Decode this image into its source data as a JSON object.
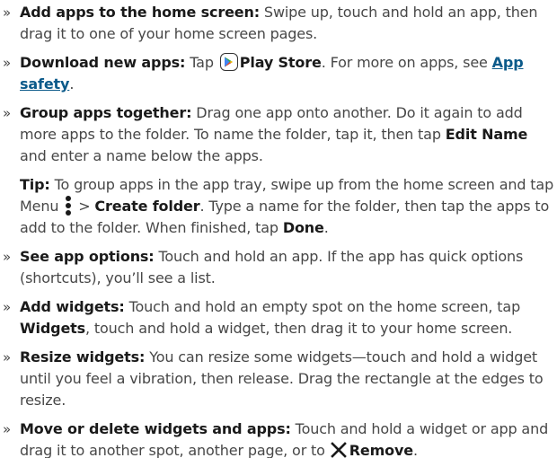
{
  "bullet_glyph": "»",
  "items": [
    {
      "title": "Add apps to the home screen:",
      "text": " Swipe up, touch and hold an app, then drag it to one of your home screen pages."
    },
    {
      "title": "Download new apps:",
      "text_before": " Tap ",
      "icon": "play-store-icon",
      "store_label": "Play Store",
      "text_after": ". For more on apps, see ",
      "link": "App safety",
      "end": "."
    },
    {
      "title": "Group apps together:",
      "text": " Drag one app onto another. Do it again to add more apps to the folder. To name the folder, tap it, then tap ",
      "action": "Edit Name",
      "text_end": " and enter a name below the apps."
    }
  ],
  "tip": {
    "title": "Tip:",
    "text1": " To group apps in the app tray, swipe up from the home screen and tap Menu ",
    "icon": "menu-dots-icon",
    "sep": " > ",
    "action1": "Create folder",
    "text2": ". Type a name for the folder, then tap the apps to add to the folder. When finished, tap ",
    "action2": "Done",
    "end": "."
  },
  "items2": [
    {
      "title": "See app options:",
      "text": " Touch and hold an app. If the app has quick options (shortcuts), you’ll see a list."
    },
    {
      "title": "Add widgets:",
      "text": " Touch and hold an empty spot on the home screen, tap ",
      "action": "Widgets",
      "text_end": ", touch and hold a widget, then drag it to your home screen."
    },
    {
      "title": "Resize widgets:",
      "text": " You can resize some widgets—touch and hold a widget until you feel a vibration, then release. Drag the rectangle at the edges to resize."
    },
    {
      "title": "Move or delete widgets and apps:",
      "text": " Touch and hold a widget or app and drag it to another spot, another page, or to ",
      "icon": "close-x-icon",
      "action": "Remove",
      "end": "."
    }
  ],
  "colors": {
    "body_text": "#474747",
    "bold_text": "#1a1a1a",
    "link": "#0b5a8a"
  }
}
